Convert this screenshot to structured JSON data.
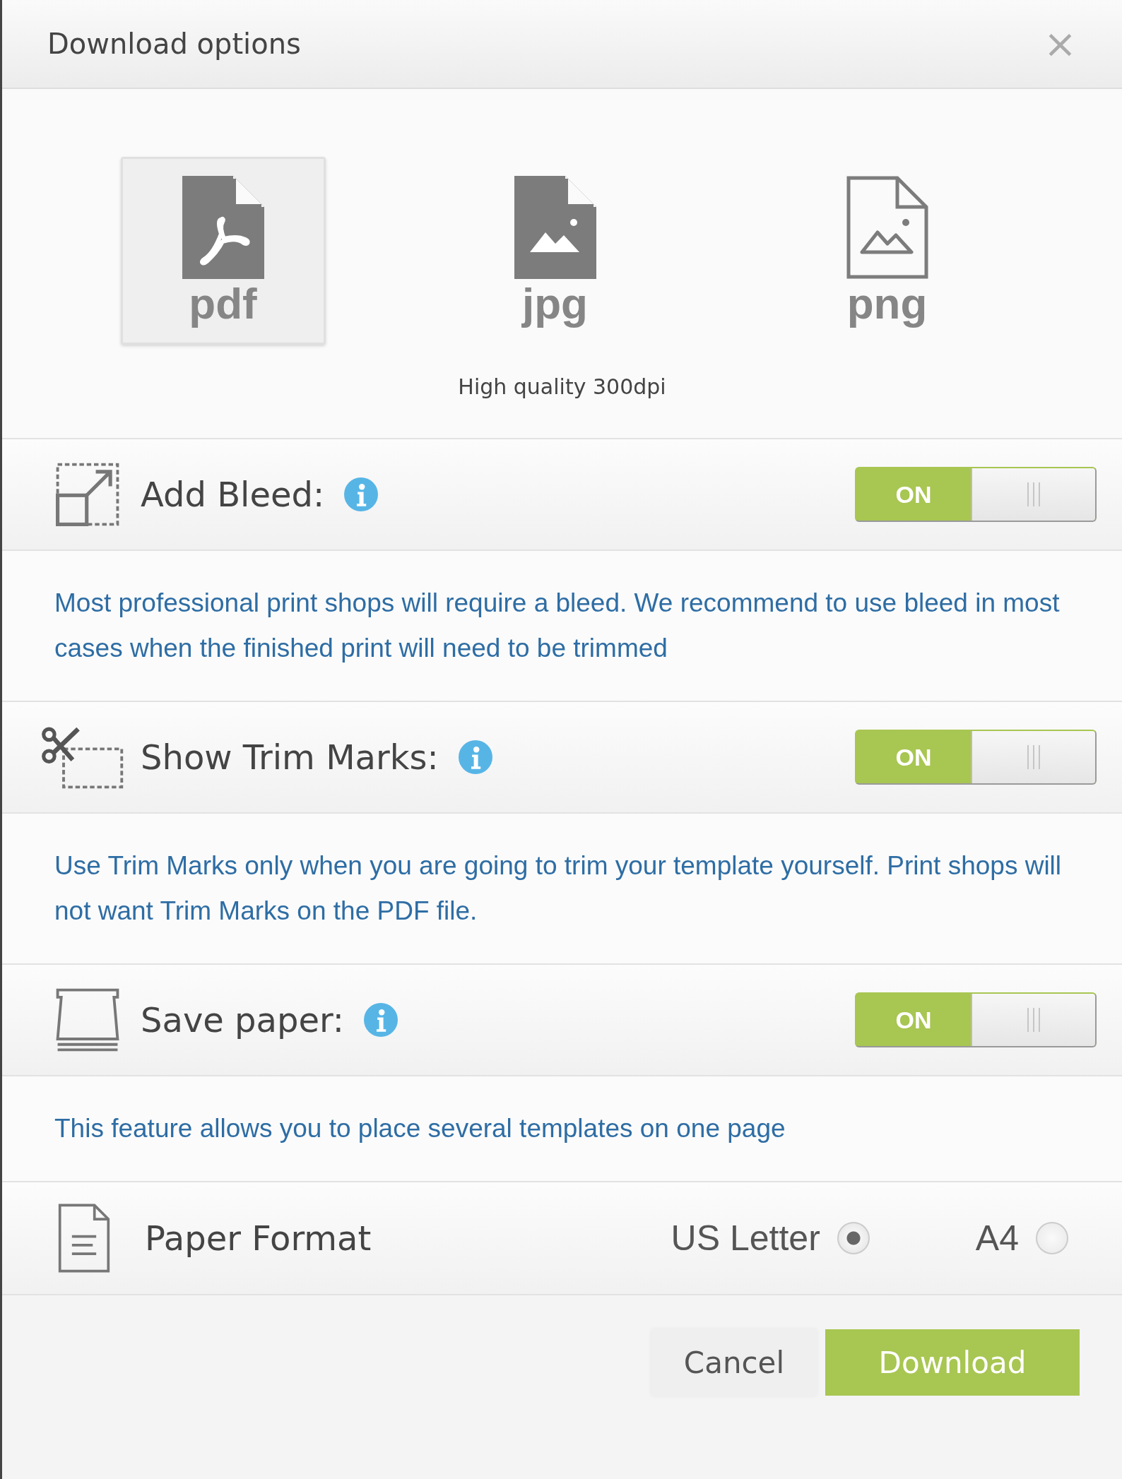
{
  "window": {
    "title": "Download options",
    "close": "×"
  },
  "formats": [
    {
      "label": "pdf",
      "selected": true
    },
    {
      "label": "jpg",
      "selected": false
    },
    {
      "label": "png",
      "selected": false
    }
  ],
  "format_note": "High quality 300dpi",
  "options": [
    {
      "label": "Add Bleed:",
      "toggle": "ON",
      "on": true,
      "description": "Most professional print shops will require a bleed. We recommend to use bleed in most cases when the finished print will need to be trimmed"
    },
    {
      "label": "Show Trim Marks:",
      "toggle": "ON",
      "on": true,
      "description": "Use Trim Marks only when you are going to trim your template yourself. Print shops will not want Trim Marks on the PDF file."
    },
    {
      "label": "Save paper:",
      "toggle": "ON",
      "on": true,
      "description": "This feature allows you to place several templates on one page"
    }
  ],
  "paper_format": {
    "label": "Paper Format",
    "choices": [
      {
        "label": "US Letter",
        "selected": true
      },
      {
        "label": "A4",
        "selected": false
      }
    ]
  },
  "buttons": [
    {
      "label": "Cancel",
      "kind": "secondary"
    },
    {
      "label": "Download",
      "kind": "primary"
    }
  ]
}
